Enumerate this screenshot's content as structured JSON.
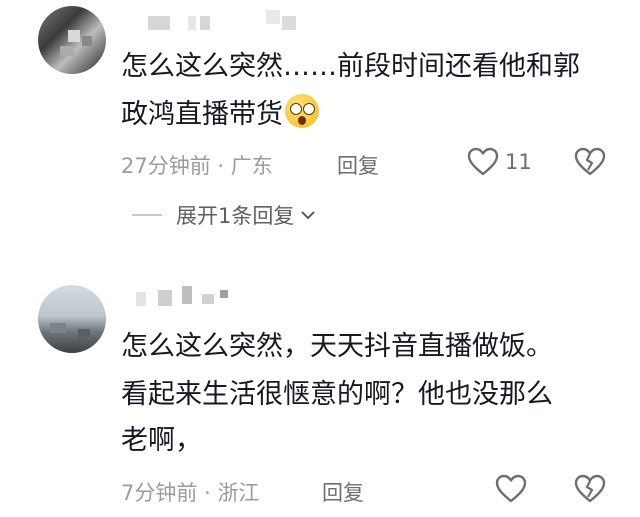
{
  "comments": [
    {
      "text_line1": "怎么这么突然……前段时间还看他和郭",
      "text_line2": "政鸿直播带货",
      "time": "27分钟前",
      "sep": "·",
      "location": "广东",
      "reply_label": "回复",
      "likes": "11",
      "emoji": "astonished-face"
    },
    {
      "text_line1": "怎么这么突然，天天抖音直播做饭。",
      "text_line2": "看起来生活很惬意的啊？他也没那么",
      "text_line3": "老啊，",
      "time": "7分钟前",
      "sep": "·",
      "location": "浙江",
      "reply_label": "回复"
    }
  ],
  "expand_replies": "展开1条回复",
  "icons": {
    "like": "heart-outline-icon",
    "dislike": "broken-heart-icon",
    "expand": "chevron-down-icon"
  },
  "colors": {
    "text": "#161823",
    "meta": "#9a9ba0",
    "icon": "#6d6e74"
  }
}
